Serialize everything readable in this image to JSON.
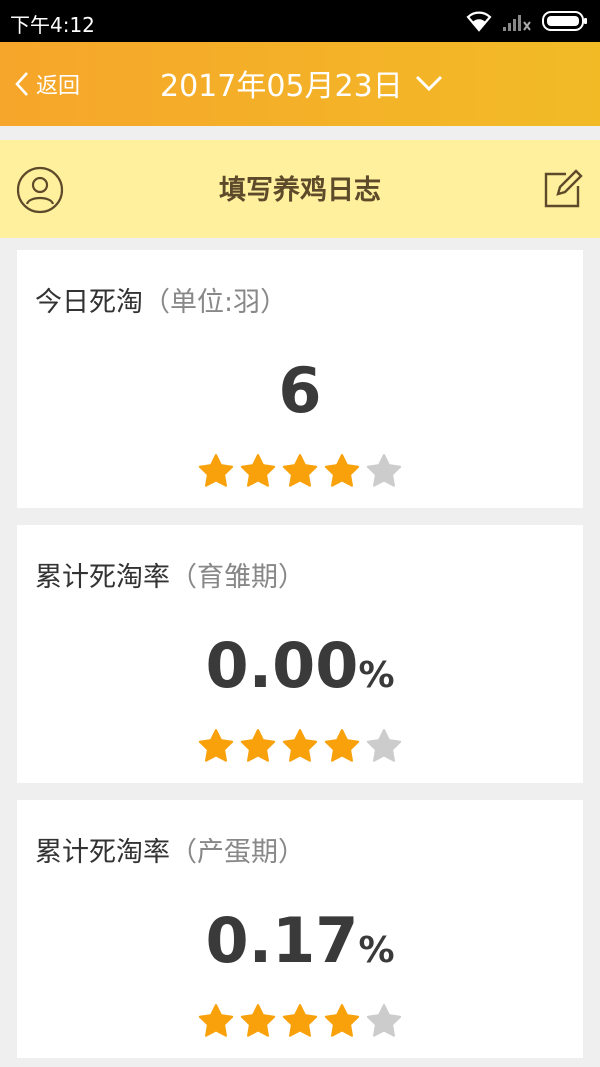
{
  "status_bar": {
    "time": "下午4:12"
  },
  "header": {
    "back_label": "返回",
    "date": "2017年05月23日"
  },
  "subheader": {
    "title": "填写养鸡日志"
  },
  "colors": {
    "accent_orange": "#f6a62a",
    "subheader_bg": "#fff09e",
    "star_active": "#f8a10b",
    "star_inactive": "#cccccc"
  },
  "cards": [
    {
      "title": "今日死淘",
      "unit": "（单位:羽）",
      "value": "6",
      "value_suffix": "",
      "rating": 4,
      "rating_max": 5
    },
    {
      "title": "累计死淘率",
      "unit": "（育雏期）",
      "value": "0.00",
      "value_suffix": "%",
      "rating": 4,
      "rating_max": 5
    },
    {
      "title": "累计死淘率",
      "unit": "（产蛋期）",
      "value": "0.17",
      "value_suffix": "%",
      "rating": 4,
      "rating_max": 5
    }
  ]
}
